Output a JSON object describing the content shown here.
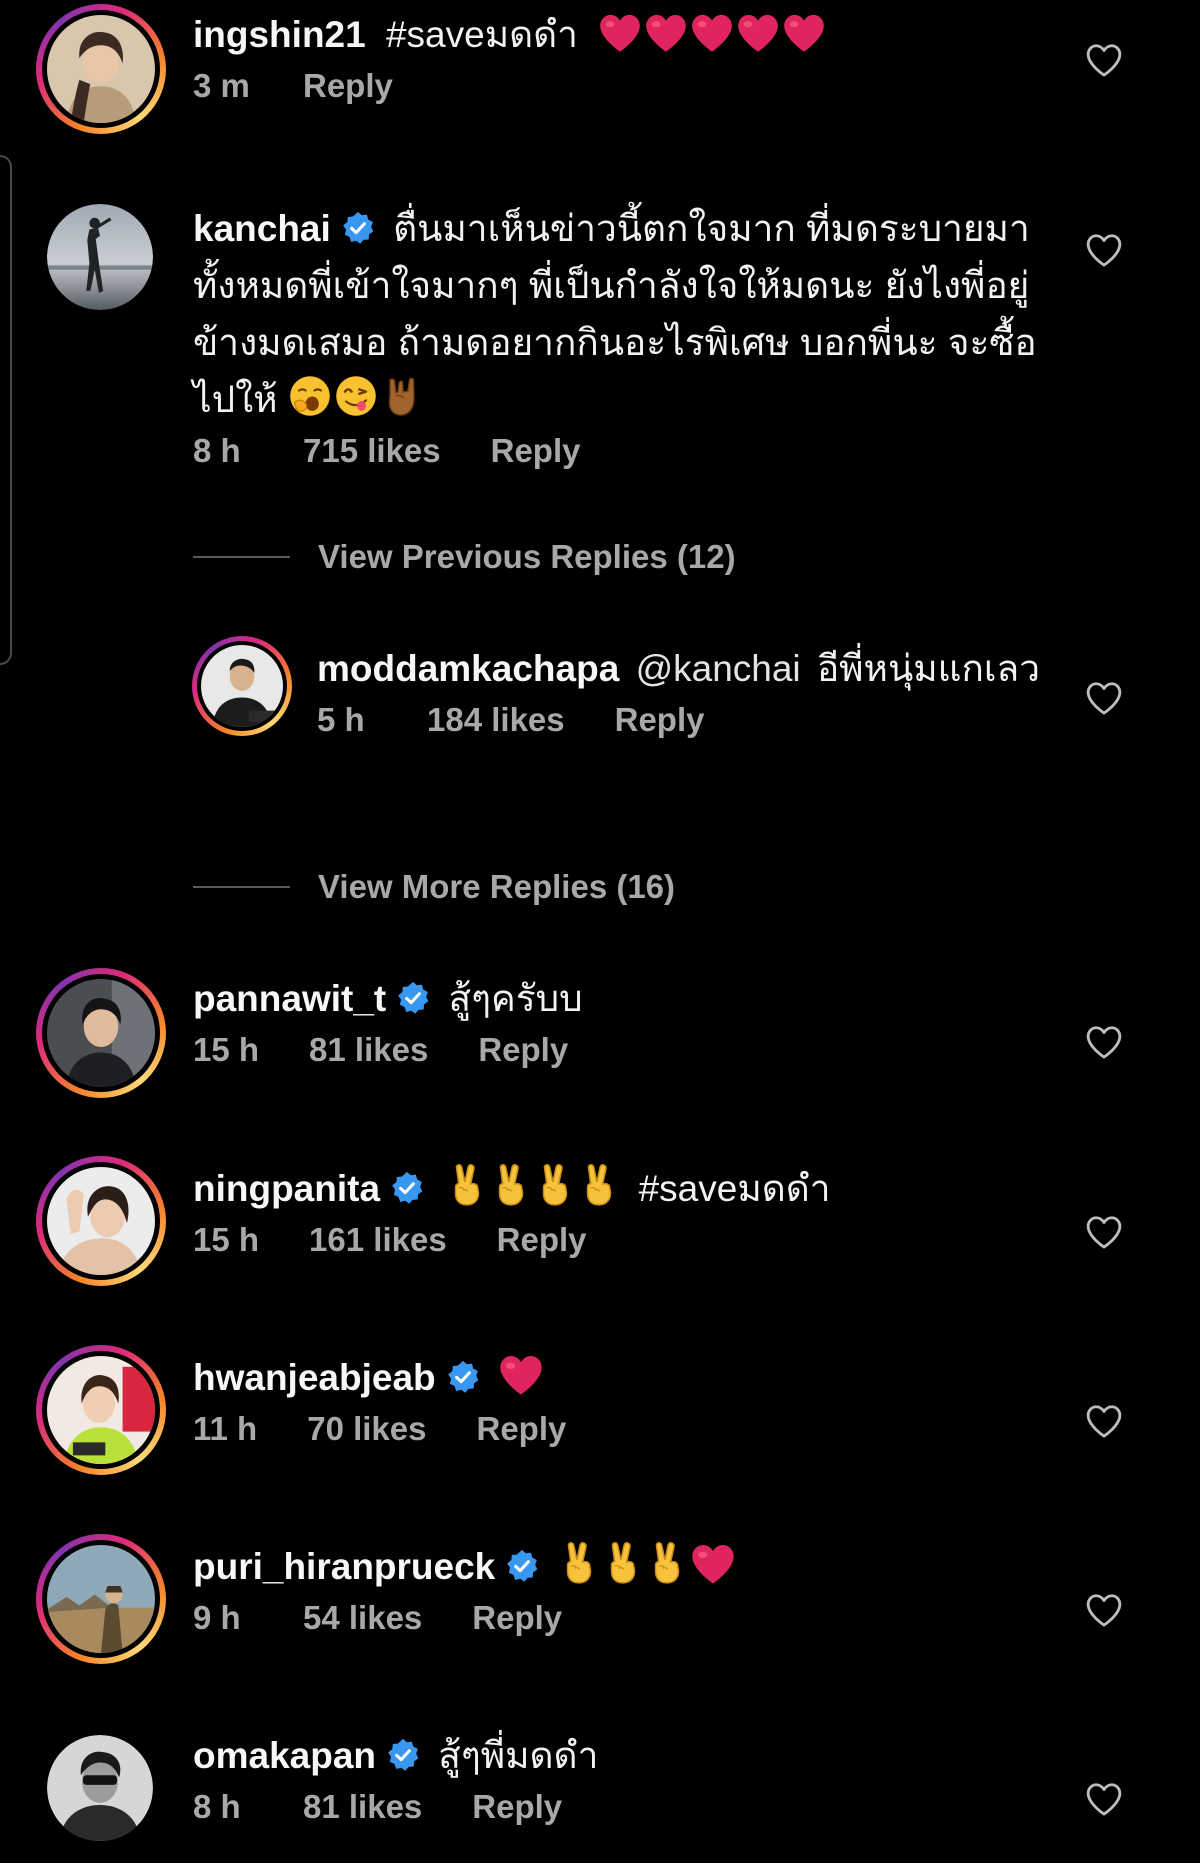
{
  "comments": [
    {
      "username": "ingshin21",
      "verified": false,
      "text": "#saveมดดำ",
      "time": "3 m",
      "likes": "",
      "reply_label": "Reply",
      "avatar_icon": "user-photo"
    },
    {
      "username": "kanchai",
      "verified": true,
      "text": "ตื่นมาเห็นข่าวนี้ตกใจมาก ที่มดระบายมาทั้งหมดพี่เข้าใจมากๆ พี่เป็นกำลังใจให้มดนะ ยังไงพี่อยู่ข้างมดเสมอ ถ้ามดอยากกินอะไรพิเศษ บอกพี่นะ จะซื้อไปให้",
      "time": "8 h",
      "likes": "715 likes",
      "reply_label": "Reply",
      "avatar_icon": "user-photo"
    },
    {
      "username": "pannawit_t",
      "verified": true,
      "text": "สู้ๆครับบ",
      "time": "15 h",
      "likes": "81 likes",
      "reply_label": "Reply"
    },
    {
      "username": "ningpanita",
      "verified": true,
      "text": "#saveมดดำ",
      "time": "15 h",
      "likes": "161 likes",
      "reply_label": "Reply"
    },
    {
      "username": "hwanjeabjeab",
      "verified": true,
      "text": "",
      "time": "11 h",
      "likes": "70 likes",
      "reply_label": "Reply"
    },
    {
      "username": "puri_hiranprueck",
      "verified": true,
      "text": "",
      "time": "9 h",
      "likes": "54 likes",
      "reply_label": "Reply"
    },
    {
      "username": "omakapan",
      "verified": true,
      "text": "สู้ๆพี่มดดำ",
      "time": "8 h",
      "likes": "81 likes",
      "reply_label": "Reply"
    }
  ],
  "thread": {
    "view_previous": "View Previous Replies (12)",
    "view_more": "View More Replies (16)",
    "reply": {
      "username": "moddamkachapa",
      "mention": "@kanchai",
      "text": "อีพี่หนุ่มแกเลว",
      "time": "5 h",
      "likes": "184 likes",
      "reply_label": "Reply"
    }
  },
  "icons": {
    "like": "heart-outline-icon",
    "verified": "verified-badge-icon",
    "emoji_heart": "red-heart-emoji",
    "emoji_victory": "victory-hand-emoji",
    "emoji_yawn": "yawning-face-emoji",
    "emoji_yum": "savoring-food-face-emoji",
    "emoji_rock": "sign-of-horns-emoji"
  },
  "colors": {
    "background": "#000000",
    "text": "#f2f2f2",
    "meta": "#a8a8a8",
    "verified": "#3897f0",
    "heart_emoji": "#e0245e"
  }
}
